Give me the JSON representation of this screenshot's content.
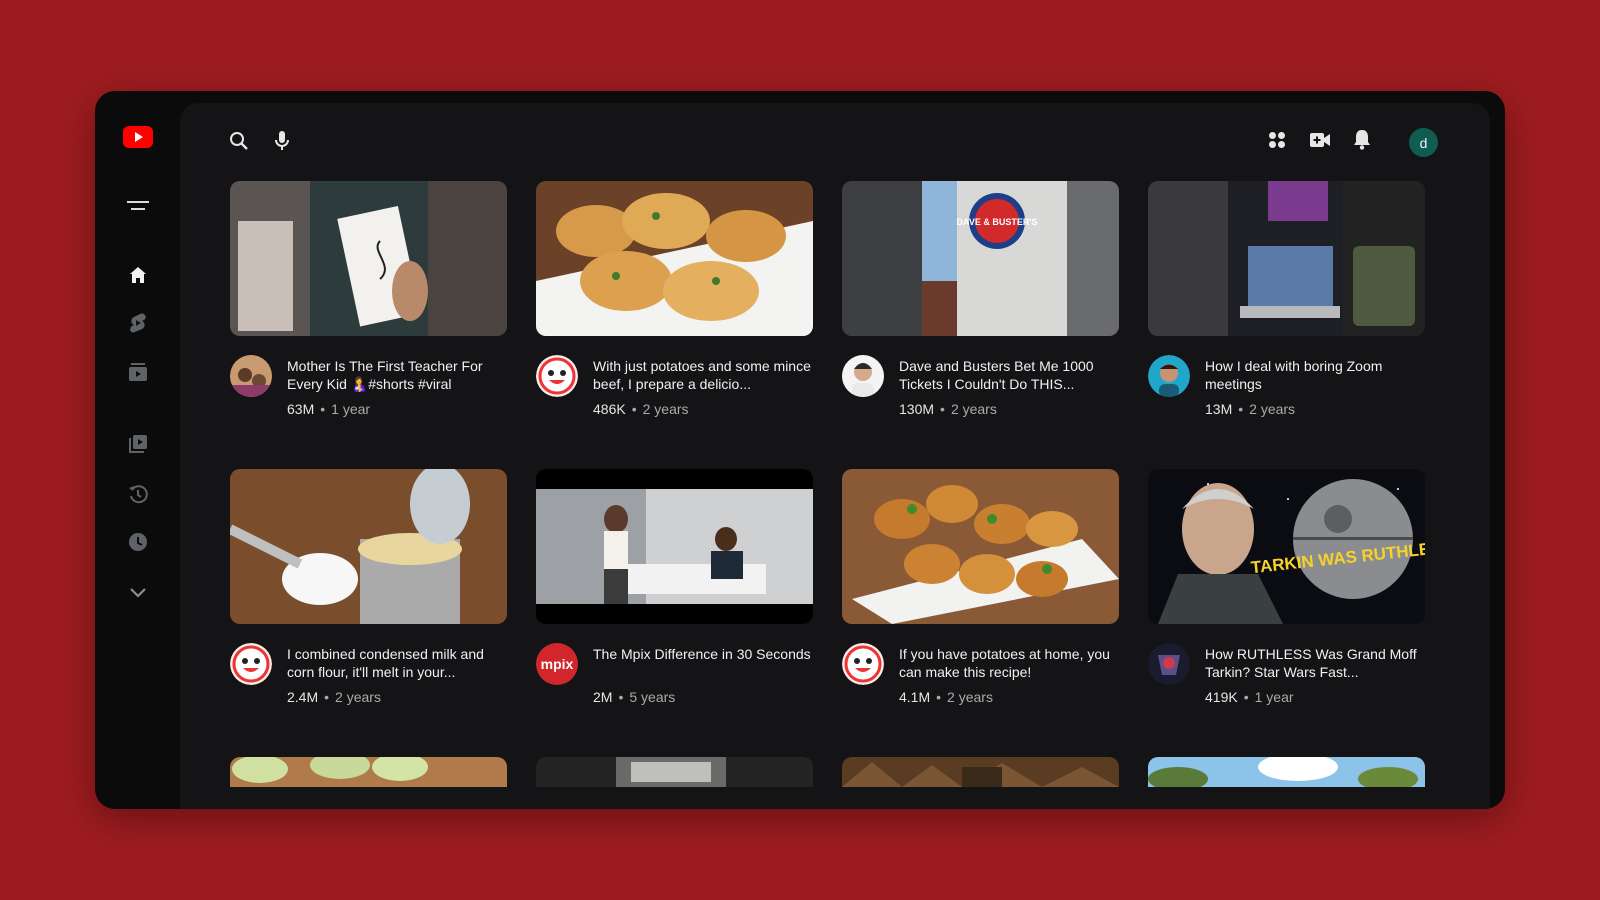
{
  "sidebar": {
    "items": [
      "logo-icon",
      "menu-icon",
      "home-icon",
      "shorts-icon",
      "subscriptions-icon",
      "library-icon",
      "history-icon",
      "watch-later-icon",
      "chevron-down-icon"
    ]
  },
  "header": {
    "icons": [
      "search-icon",
      "mic-icon",
      "apps-icon",
      "create-video-icon",
      "bell-icon"
    ],
    "avatar_letter": "d"
  },
  "colors": {
    "brand": "#ff0000",
    "background": "#9e1c1f",
    "surface": "#141416",
    "avatar": "#0f5c52"
  },
  "videos": [
    {
      "title": "Mother Is The First Teacher For Every Kid 🤱#shorts #viral",
      "views": "63M",
      "age": "1 year",
      "channel_avatar_text": ""
    },
    {
      "title": "With just potatoes and some mince beef, I prepare a delicio...",
      "views": "486K",
      "age": "2 years",
      "channel_avatar_text": ""
    },
    {
      "title": "Dave and Busters Bet Me 1000 Tickets I Couldn't Do THIS...",
      "views": "130M",
      "age": "2 years",
      "channel_avatar_text": "",
      "thumb_logo": "DAVE & BUSTER'S"
    },
    {
      "title": "How I deal with boring Zoom meetings",
      "views": "13M",
      "age": "2 years",
      "channel_avatar_text": ""
    },
    {
      "title": "I combined condensed milk and corn flour, it'll melt in your...",
      "views": "2.4M",
      "age": "2 years",
      "channel_avatar_text": ""
    },
    {
      "title": "The Mpix Difference in 30 Seconds",
      "views": "2M",
      "age": "5 years",
      "channel_avatar_text": "mpix"
    },
    {
      "title": "If you have potatoes at home, you can make this recipe!",
      "views": "4.1M",
      "age": "2 years",
      "channel_avatar_text": ""
    },
    {
      "title": "How RUTHLESS Was Grand Moff Tarkin? Star Wars Fast...",
      "views": "419K",
      "age": "1 year",
      "channel_avatar_text": "",
      "thumb_text": "TARKIN WAS RUTHLESS!!"
    }
  ]
}
